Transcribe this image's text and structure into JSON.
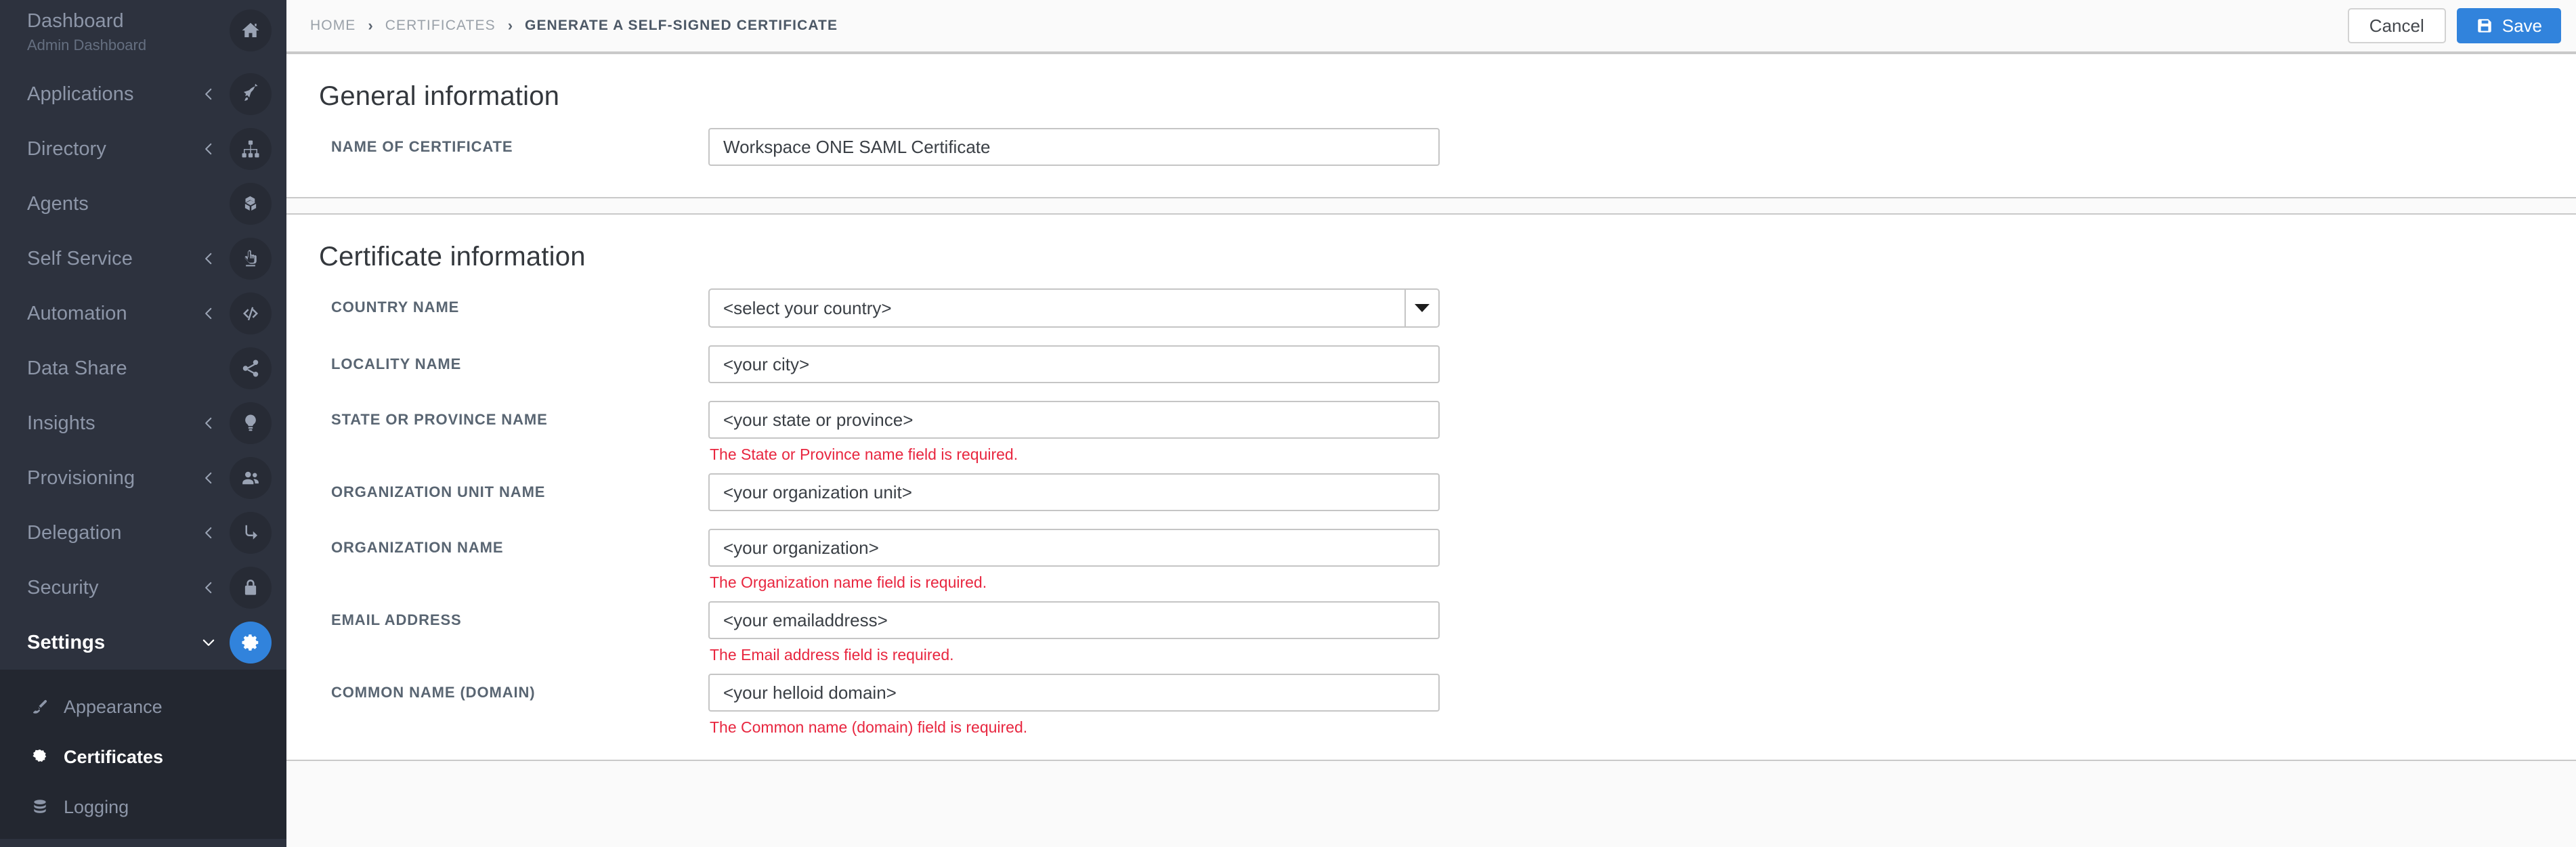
{
  "sidebar": {
    "items": [
      {
        "label": "Dashboard",
        "sublabel": "Admin Dashboard",
        "icon": "home-icon",
        "caret": "none",
        "active": false
      },
      {
        "label": "Applications",
        "sublabel": "",
        "icon": "rocket-icon",
        "caret": "left",
        "active": false
      },
      {
        "label": "Directory",
        "sublabel": "",
        "icon": "sitemap-icon",
        "caret": "left",
        "active": false
      },
      {
        "label": "Agents",
        "sublabel": "",
        "icon": "boxes-icon",
        "caret": "none",
        "active": false
      },
      {
        "label": "Self Service",
        "sublabel": "",
        "icon": "hand-pointer-icon",
        "caret": "left",
        "active": false
      },
      {
        "label": "Automation",
        "sublabel": "",
        "icon": "code-icon",
        "caret": "left",
        "active": false
      },
      {
        "label": "Data Share",
        "sublabel": "",
        "icon": "share-icon",
        "caret": "none",
        "active": false
      },
      {
        "label": "Insights",
        "sublabel": "",
        "icon": "lightbulb-icon",
        "caret": "left",
        "active": false
      },
      {
        "label": "Provisioning",
        "sublabel": "",
        "icon": "users-icon",
        "caret": "left",
        "active": false
      },
      {
        "label": "Delegation",
        "sublabel": "",
        "icon": "arrow-turn-down-icon",
        "caret": "left",
        "active": false
      },
      {
        "label": "Security",
        "sublabel": "",
        "icon": "lock-icon",
        "caret": "left",
        "active": false
      },
      {
        "label": "Settings",
        "sublabel": "",
        "icon": "gear-icon",
        "caret": "down",
        "active": true
      }
    ],
    "submenu": [
      {
        "label": "Appearance",
        "icon": "paintbrush-icon",
        "active": false
      },
      {
        "label": "Certificates",
        "icon": "certificate-icon",
        "active": true
      },
      {
        "label": "Logging",
        "icon": "database-icon",
        "active": false
      }
    ]
  },
  "topbar": {
    "breadcrumb": [
      {
        "label": "Home",
        "current": false
      },
      {
        "label": "Certificates",
        "current": false
      },
      {
        "label": "Generate a self-signed certificate",
        "current": true
      }
    ],
    "separator": "›",
    "cancel_label": "Cancel",
    "save_label": "Save",
    "save_icon": "floppy-disk-icon"
  },
  "general_information": {
    "title": "General information",
    "fields": [
      {
        "label": "Name of certificate",
        "name": "name-of-certificate",
        "type": "text",
        "value": "Workspace ONE SAML Certificate",
        "error": ""
      }
    ]
  },
  "certificate_information": {
    "title": "Certificate information",
    "fields": [
      {
        "label": "Country name",
        "name": "country-name",
        "type": "select",
        "value": "<select your country>",
        "error": ""
      },
      {
        "label": "Locality name",
        "name": "locality-name",
        "type": "text",
        "value": "<your city>",
        "error": ""
      },
      {
        "label": "State or province name",
        "name": "state-or-province-name",
        "type": "text",
        "value": "<your state or province>",
        "error": "The State or Province name field is required."
      },
      {
        "label": "Organization unit name",
        "name": "organization-unit-name",
        "type": "text",
        "value": "<your organization unit>",
        "error": ""
      },
      {
        "label": "Organization name",
        "name": "organization-name",
        "type": "text",
        "value": "<your organization>",
        "error": "The Organization name field is required."
      },
      {
        "label": "Email address",
        "name": "email-address",
        "type": "text",
        "value": "<your emailaddress>",
        "error": "The Email address field is required."
      },
      {
        "label": "Common name (domain)",
        "name": "common-name-domain",
        "type": "text",
        "value": "<your helloid domain>",
        "error": "The Common name (domain) field is required."
      }
    ]
  },
  "colors": {
    "accent": "#3183dc",
    "sidebar_bg": "#2d323e",
    "submenu_bg": "#232730",
    "error": "#e8263f",
    "label": "#596572"
  }
}
